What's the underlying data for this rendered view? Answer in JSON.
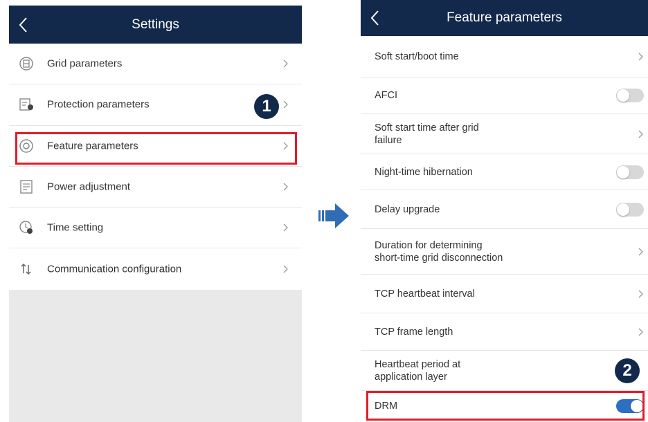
{
  "left_screen": {
    "title": "Settings",
    "items": [
      {
        "label": "Grid parameters",
        "icon": "grid-icon"
      },
      {
        "label": "Protection parameters",
        "icon": "protection-icon"
      },
      {
        "label": "Feature parameters",
        "icon": "feature-icon"
      },
      {
        "label": "Power adjustment",
        "icon": "power-icon"
      },
      {
        "label": "Time setting",
        "icon": "clock-icon"
      },
      {
        "label": "Communication configuration",
        "icon": "communication-icon"
      }
    ],
    "step_badge": "1"
  },
  "right_screen": {
    "title": "Feature parameters",
    "items": [
      {
        "label": "Soft start/boot time",
        "control": "chevron"
      },
      {
        "label": "AFCI",
        "control": "toggle-off"
      },
      {
        "label": "Soft start time after grid failure",
        "control": "chevron"
      },
      {
        "label": "Night-time hibernation",
        "control": "toggle-off"
      },
      {
        "label": "Delay upgrade",
        "control": "toggle-off"
      },
      {
        "label": "Duration for determining short-time grid disconnection",
        "control": "chevron"
      },
      {
        "label": "TCP heartbeat interval",
        "control": "chevron"
      },
      {
        "label": "TCP frame length",
        "control": "chevron"
      },
      {
        "label": "Heartbeat period at application layer",
        "control": "none"
      },
      {
        "label": "DRM",
        "control": "toggle-on"
      }
    ],
    "step_badge": "2"
  },
  "colors": {
    "header": "#13294b",
    "highlight": "#e21d2a",
    "toggle_on": "#2d6fc2",
    "arrow": "#2f6db5"
  }
}
